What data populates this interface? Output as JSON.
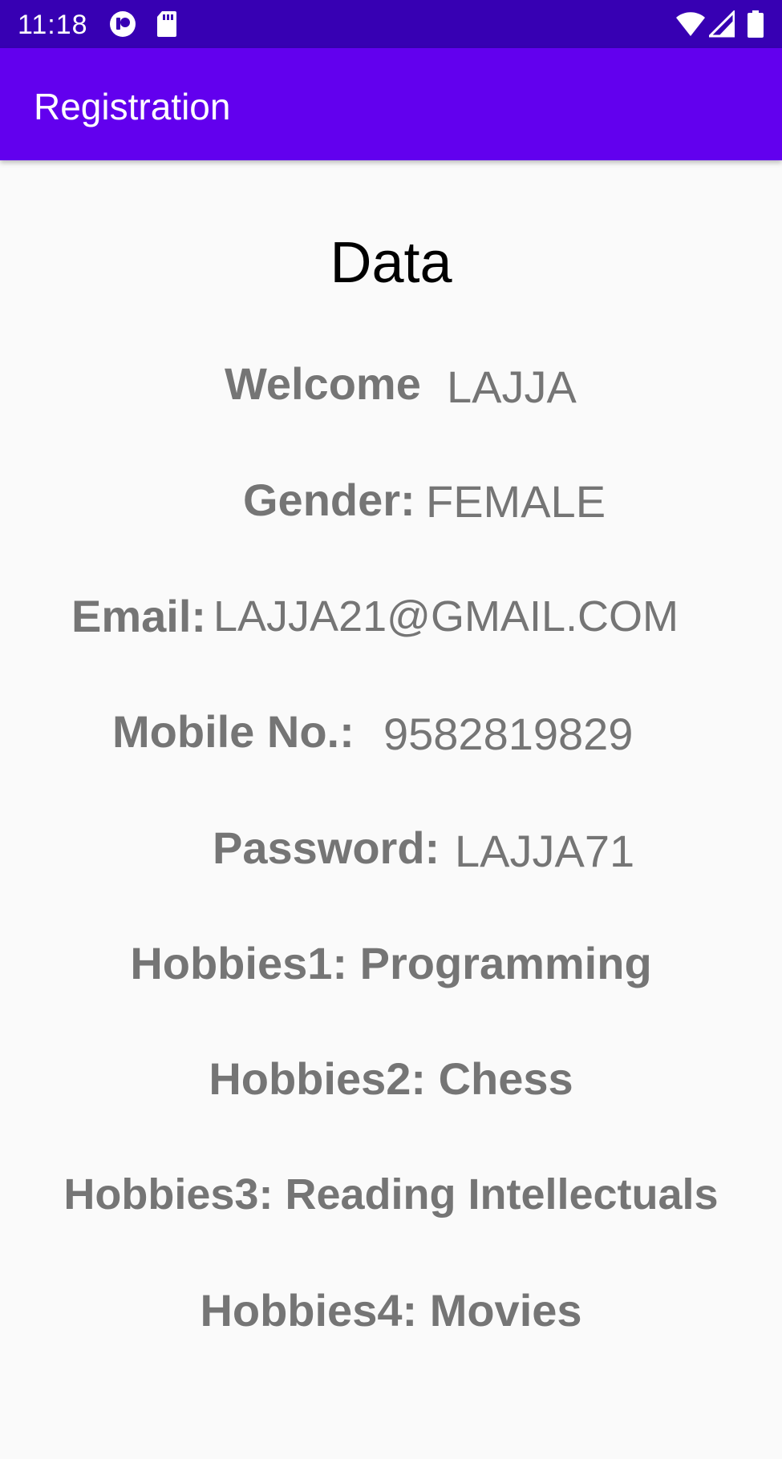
{
  "status_bar": {
    "time": "11:18",
    "icons": [
      "notification-icon",
      "sd-card-icon",
      "wifi-icon",
      "signal-icon",
      "battery-icon"
    ]
  },
  "app_bar": {
    "title": "Registration"
  },
  "main": {
    "heading": "Data",
    "welcome_label": "Welcome",
    "welcome_value": "LAJJA",
    "gender_label": "Gender:",
    "gender_value": "FEMALE",
    "email_label": "Email:",
    "email_value": "LAJJA21@GMAIL.COM",
    "mobile_label": "Mobile No.:",
    "mobile_value": "9582819829",
    "password_label": "Password:",
    "password_value": "LAJJA71",
    "hobbies": [
      "Hobbies1: Programming",
      "Hobbies2: Chess",
      "Hobbies3: Reading Intellectuals",
      "Hobbies4: Movies"
    ]
  },
  "colors": {
    "status_bar": "#3700b3",
    "app_bar": "#6200ee",
    "text_gray": "#757575",
    "background": "#fafafa"
  }
}
